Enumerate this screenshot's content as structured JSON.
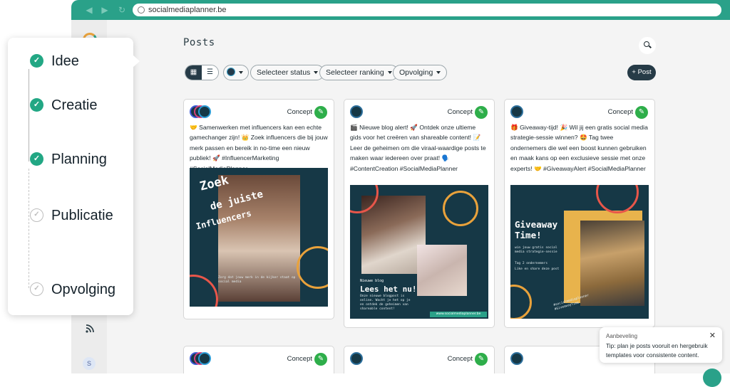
{
  "browser": {
    "url": "socialmediaplanner.be"
  },
  "page": {
    "title": "Posts"
  },
  "toolbar": {
    "filters": [
      "Selecteer status",
      "Selecteer ranking",
      "Opvolging"
    ],
    "new_post": "+ Post"
  },
  "posts": [
    {
      "status": "Concept",
      "caption": "🤝 Samenwerken met influencers kan een echte gamechanger zijn! 👑 Zoek influencers die bij jouw merk passen en bereik in no-time een nieuw publiek! 🚀 #InfluencerMarketing #SocialMediaPlanner",
      "image": {
        "line1": "Zoek",
        "line2": "de juiste",
        "line3": "Influencers",
        "small": "Zorg dat jouw merk in de kijker staat op social media"
      }
    },
    {
      "status": "Concept",
      "caption": "🎬 Nieuwe blog alert! 🚀 Ontdek onze ultieme gids voor het creëren van shareable content! 📝 Leer de geheimen om die viraal-waardige posts te maken waar iedereen over praat! 🗣️ #ContentCreation #SocialMediaPlanner",
      "image": {
        "kicker": "Nieuwe blog",
        "title": "Lees het nu!",
        "small": "Onze nieuwe blogpost is online. Wacht je het op je en ontdek de geheimen van shareable content!",
        "site": "www.socialmediaplanner.be"
      }
    },
    {
      "status": "Concept",
      "caption": "🎁 Giveaway-tijd! 🎉 Wil jij een gratis social media strategie-sessie winnen? 🤩 Tag twee ondernemers die wel een boost kunnen gebruiken en maak kans op een exclusieve sessie met onze experts! 🤝 #GiveawayAlert #SocialMediaPlanner",
      "image": {
        "title": "Giveaway Time!",
        "small": "win jouw gratis social media strategie-sessie",
        "point1": "Tag 2 ondernemers",
        "point2": "Like en share deze post",
        "tags": "#socialmediaplanner #GiveawayTime"
      }
    }
  ],
  "posts_row2": [
    {
      "status": "Concept"
    },
    {
      "status": "Concept"
    }
  ],
  "steps": [
    {
      "label": "Idee",
      "done": true
    },
    {
      "label": "Creatie",
      "done": true
    },
    {
      "label": "Planning",
      "done": true
    },
    {
      "label": "Publicatie",
      "done": false
    },
    {
      "label": "Opvolging",
      "done": false
    }
  ],
  "tip": {
    "heading": "Aanbeveling",
    "body": "Tip: plan je posts vooruit en hergebruik templates voor consistente content."
  },
  "sidebar": {
    "user_initial": "S"
  },
  "colors": {
    "accent": "#2aa189",
    "dark": "#263b47",
    "edit_green": "#2eae4a",
    "post_bg": "#163846"
  }
}
